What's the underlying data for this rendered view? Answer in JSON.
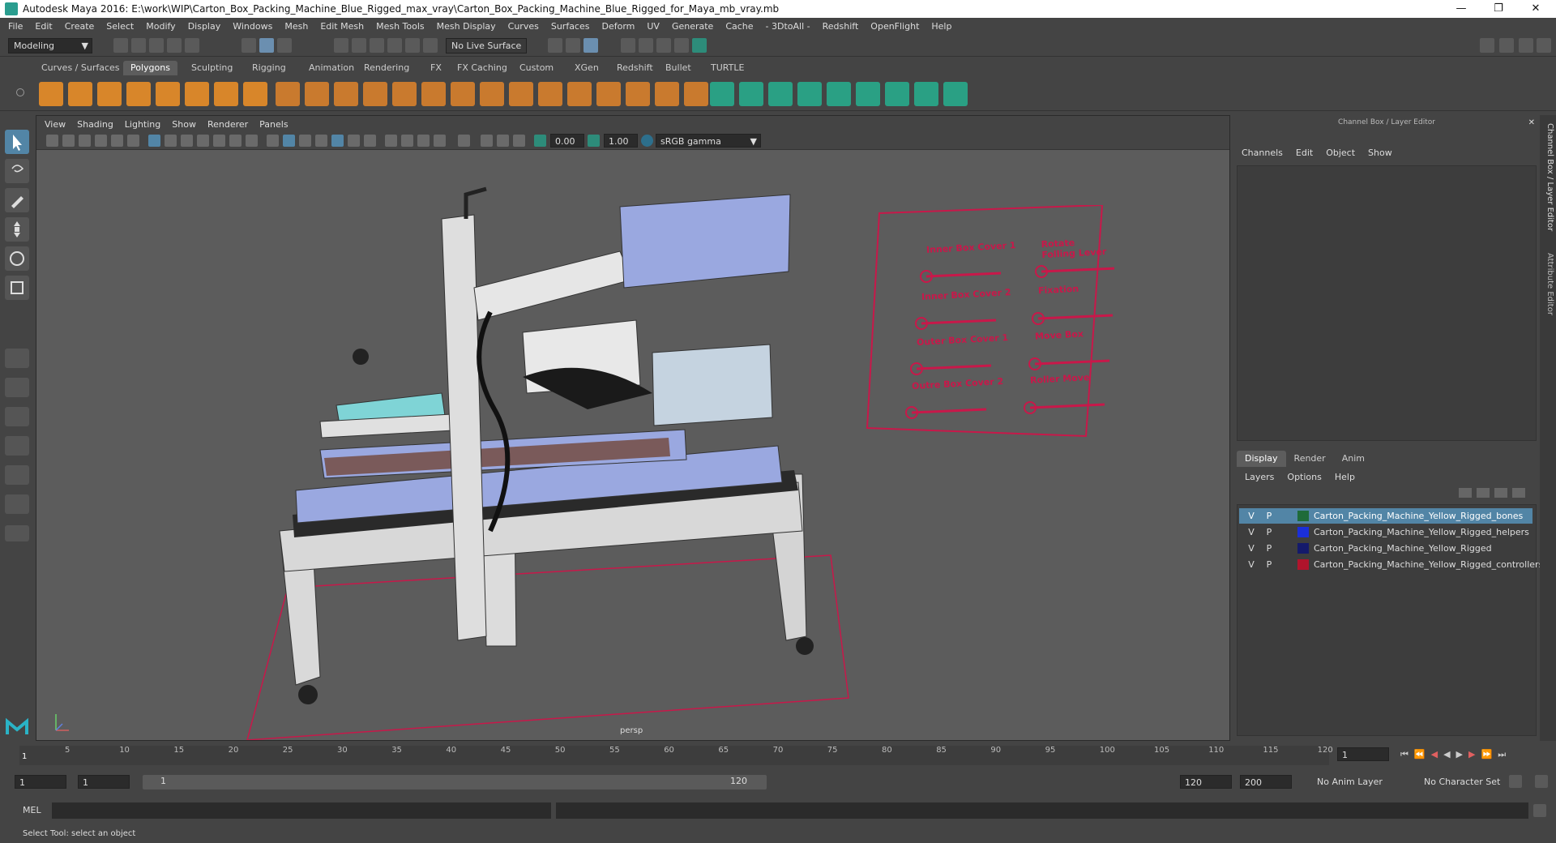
{
  "window": {
    "title": "Autodesk Maya 2016: E:\\work\\WIP\\Carton_Box_Packing_Machine_Blue_Rigged_max_vray\\Carton_Box_Packing_Machine_Blue_Rigged_for_Maya_mb_vray.mb"
  },
  "menubar": [
    "File",
    "Edit",
    "Create",
    "Select",
    "Modify",
    "Display",
    "Windows",
    "Mesh",
    "Edit Mesh",
    "Mesh Tools",
    "Mesh Display",
    "Curves",
    "Surfaces",
    "Deform",
    "UV",
    "Generate",
    "Cache",
    "- 3DtoAll -",
    "Redshift",
    "OpenFlight",
    "Help"
  ],
  "statusline": {
    "mode": "Modeling",
    "live_surface": "No Live Surface"
  },
  "shelf_tabs": [
    "Curves / Surfaces",
    "Polygons",
    "Sculpting",
    "Rigging",
    "Animation",
    "Rendering",
    "FX",
    "FX Caching",
    "Custom",
    "XGen",
    "Redshift",
    "Bullet",
    "TURTLE"
  ],
  "shelf_active": "Polygons",
  "viewport": {
    "menu": [
      "View",
      "Shading",
      "Lighting",
      "Show",
      "Renderer",
      "Panels"
    ],
    "field1": "0.00",
    "field2": "1.00",
    "colorspace": "sRGB gamma",
    "camera": "persp"
  },
  "control_panel": {
    "labels": [
      "Inner Box Cover 1",
      "Rotate Folling Lever",
      "Inner Box Cover 2",
      "Fixation",
      "Outer Box Cover 1",
      "Move Box",
      "Outre Box Cover 2",
      "Roller Move"
    ],
    "color": "#c8184a"
  },
  "channel_box": {
    "title": "Channel Box / Layer Editor",
    "menu": [
      "Channels",
      "Edit",
      "Object",
      "Show"
    ]
  },
  "side_tabs": [
    "Channel Box / Layer Editor",
    "Attribute Editor"
  ],
  "layer_editor": {
    "tabs": [
      "Display",
      "Render",
      "Anim"
    ],
    "active_tab": "Display",
    "menu": [
      "Layers",
      "Options",
      "Help"
    ],
    "layers": [
      {
        "v": "V",
        "p": "P",
        "name": "Carton_Packing_Machine_Yellow_Rigged_bones",
        "color": "#1f6b3a",
        "selected": true
      },
      {
        "v": "V",
        "p": "P",
        "name": "Carton_Packing_Machine_Yellow_Rigged_helpers",
        "color": "#1b2fd8",
        "selected": false
      },
      {
        "v": "V",
        "p": "P",
        "name": "Carton_Packing_Machine_Yellow_Rigged",
        "color": "#141a6b",
        "selected": false
      },
      {
        "v": "V",
        "p": "P",
        "name": "Carton_Packing_Machine_Yellow_Rigged_controllers",
        "color": "#b0142c",
        "selected": false
      }
    ]
  },
  "timeline": {
    "ticks": [
      "5",
      "10",
      "15",
      "20",
      "25",
      "30",
      "35",
      "40",
      "45",
      "50",
      "55",
      "60",
      "65",
      "70",
      "75",
      "80",
      "85",
      "90",
      "95",
      "100",
      "105",
      "110",
      "115",
      "120"
    ],
    "current_frame_marker": "1",
    "current_frame": "1"
  },
  "range": {
    "start": "1",
    "anim_start": "1",
    "slider_start": "1",
    "slider_end": "120",
    "anim_end_a": "120",
    "anim_end_b": "200",
    "anim_layer": "No Anim Layer",
    "char_set": "No Character Set"
  },
  "cmdline": {
    "label": "MEL"
  },
  "help_line": "Select Tool: select an object"
}
